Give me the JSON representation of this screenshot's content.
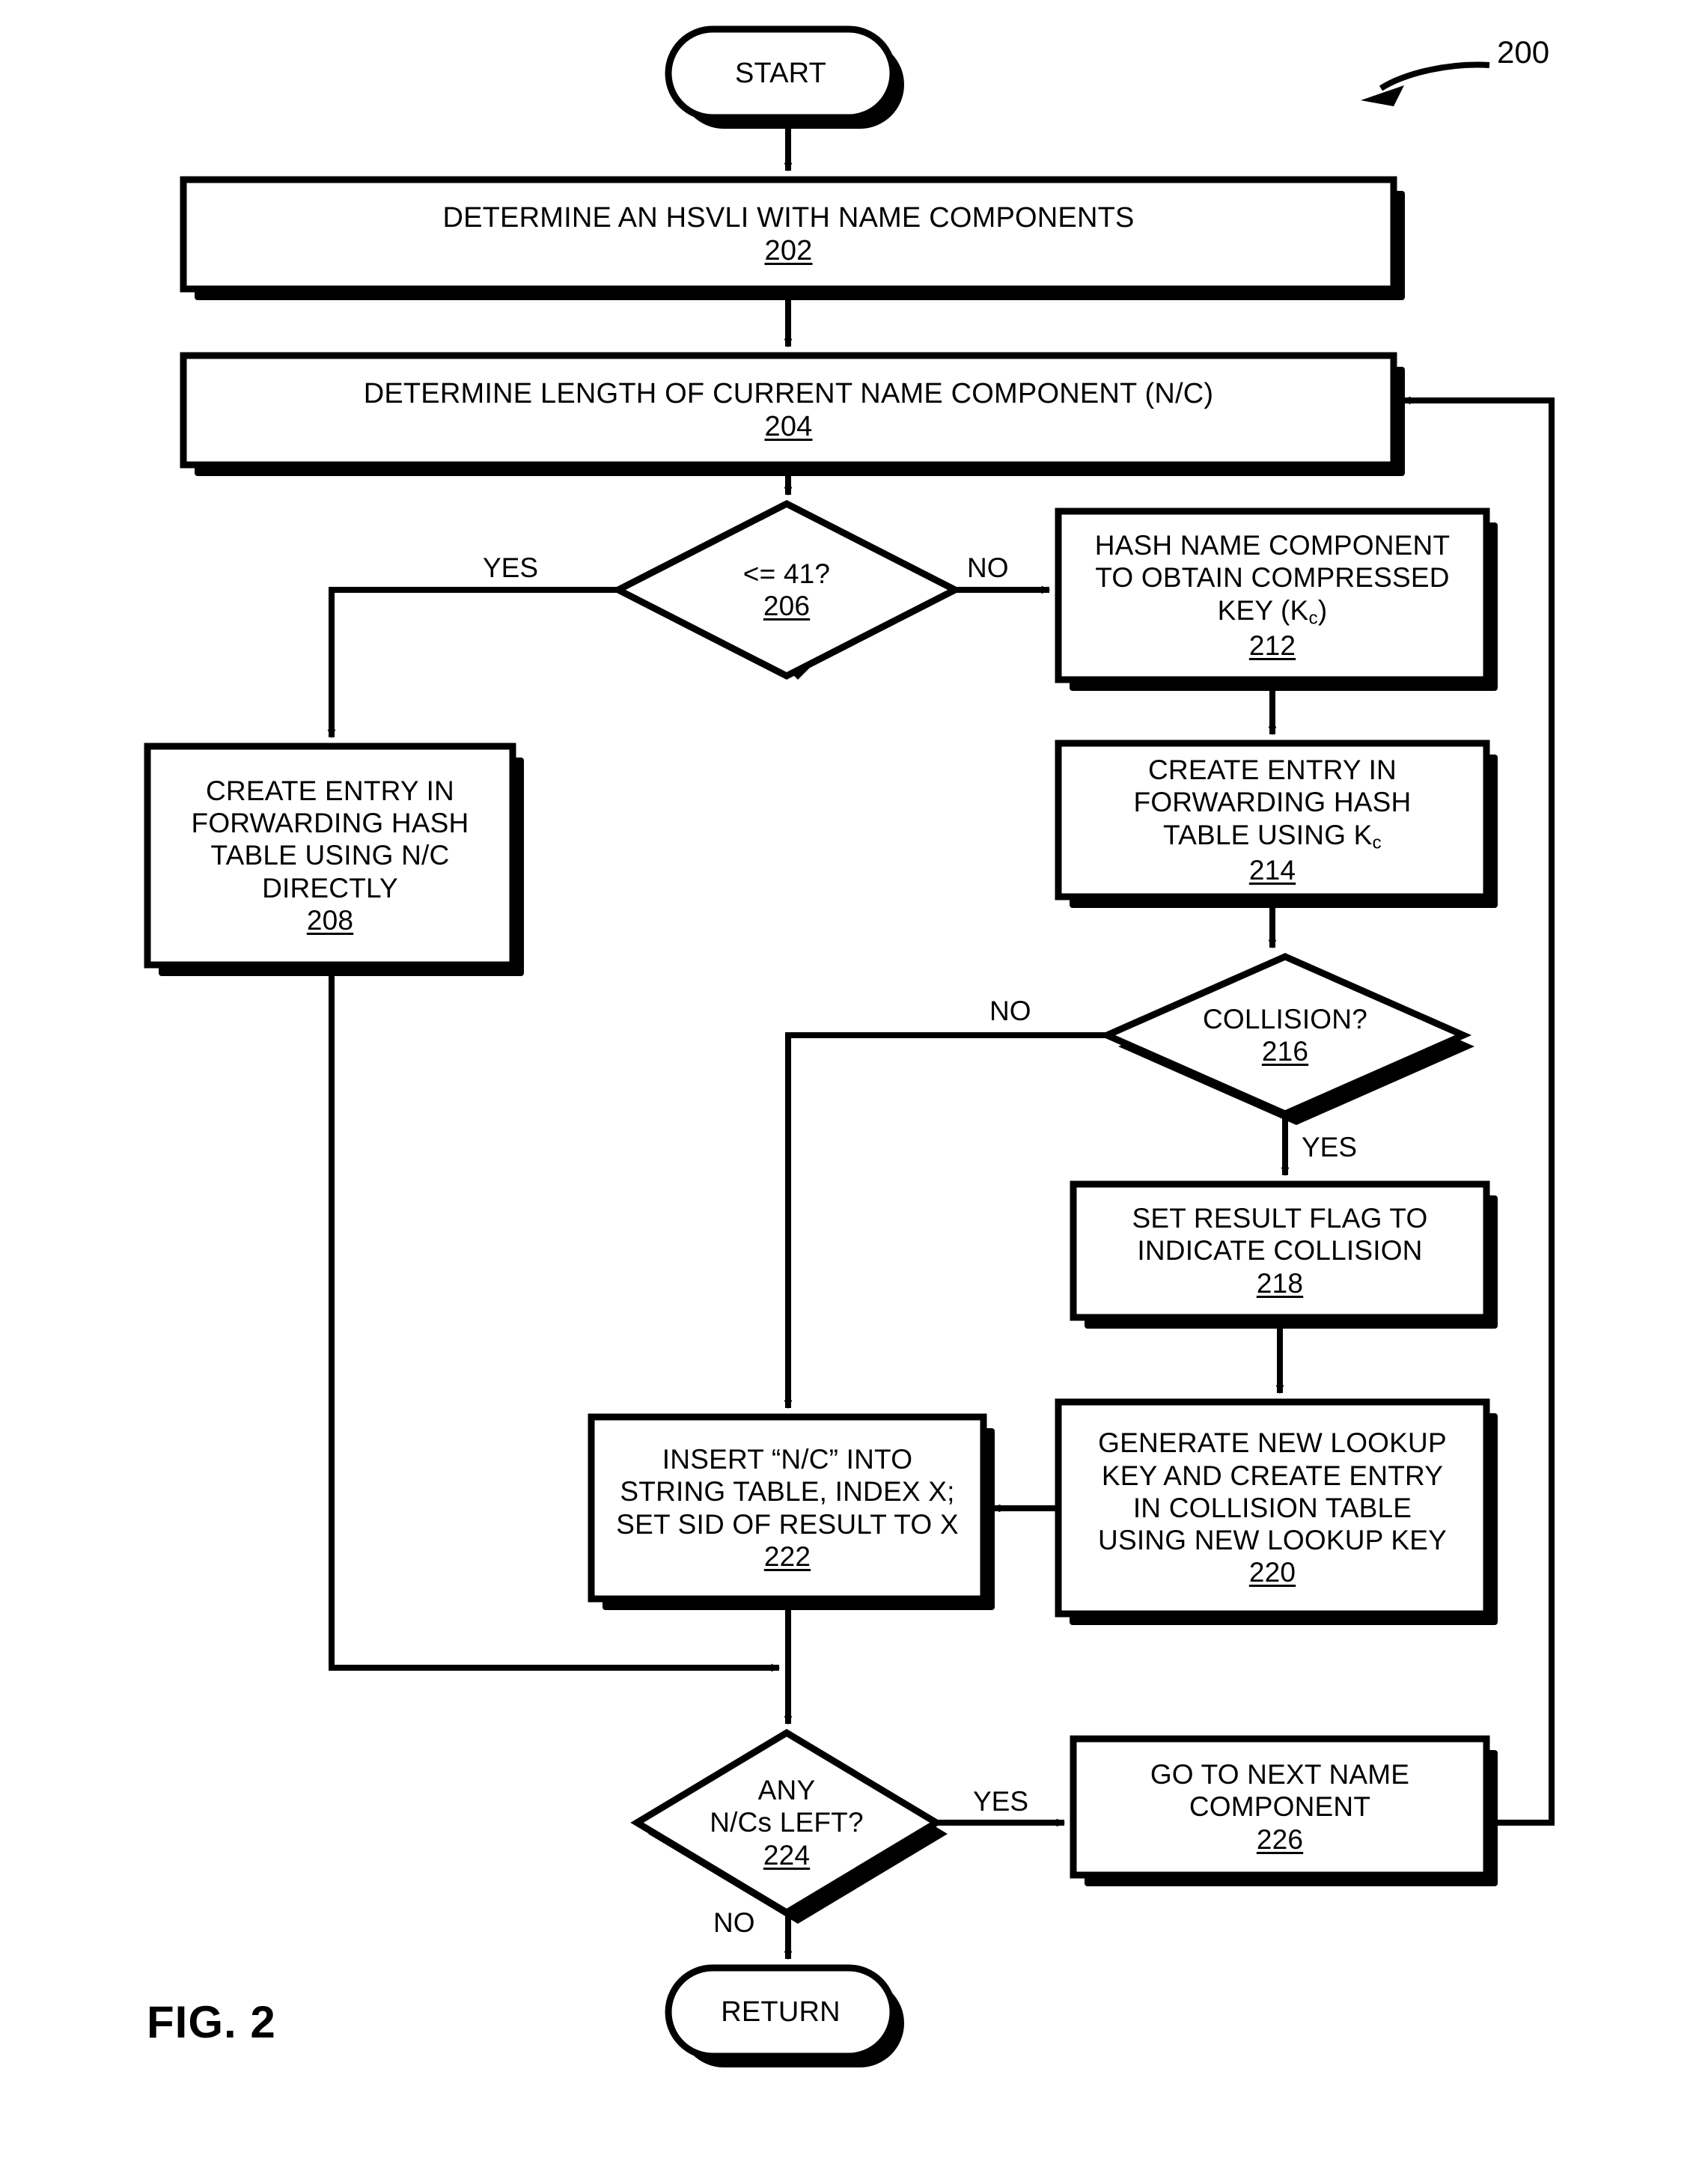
{
  "figure": {
    "label": "FIG. 2",
    "reference_numeral": "200"
  },
  "nodes": {
    "start": {
      "id": "start",
      "shape": "terminal",
      "label": "START"
    },
    "n202": {
      "id": "202",
      "shape": "process",
      "lines": [
        "DETERMINE AN HSVLI WITH NAME COMPONENTS"
      ],
      "ref": "202"
    },
    "n204": {
      "id": "204",
      "shape": "process",
      "lines": [
        "DETERMINE LENGTH OF CURRENT NAME COMPONENT (N/C)"
      ],
      "ref": "204"
    },
    "n206": {
      "id": "206",
      "shape": "decision",
      "lines": [
        "<= 41?"
      ],
      "ref": "206"
    },
    "n208": {
      "id": "208",
      "shape": "process",
      "lines": [
        "CREATE ENTRY IN",
        "FORWARDING HASH",
        "TABLE USING N/C",
        "DIRECTLY"
      ],
      "ref": "208"
    },
    "n212": {
      "id": "212",
      "shape": "process",
      "lines": [
        "HASH NAME COMPONENT",
        "TO OBTAIN COMPRESSED",
        "KEY (K<sub>c</sub>)"
      ],
      "ref": "212"
    },
    "n214": {
      "id": "214",
      "shape": "process",
      "lines": [
        "CREATE ENTRY IN",
        "FORWARDING HASH",
        "TABLE USING K<sub>c</sub>"
      ],
      "ref": "214"
    },
    "n216": {
      "id": "216",
      "shape": "decision",
      "lines": [
        "COLLISION?"
      ],
      "ref": "216"
    },
    "n218": {
      "id": "218",
      "shape": "process",
      "lines": [
        "SET RESULT FLAG TO",
        "INDICATE COLLISION"
      ],
      "ref": "218"
    },
    "n220": {
      "id": "220",
      "shape": "process",
      "lines": [
        "GENERATE NEW LOOKUP",
        "KEY AND CREATE ENTRY",
        "IN COLLISION TABLE",
        "USING NEW LOOKUP KEY"
      ],
      "ref": "220"
    },
    "n222": {
      "id": "222",
      "shape": "process",
      "lines": [
        "INSERT “N/C” INTO",
        "STRING TABLE, INDEX X;",
        "SET SID OF RESULT TO X"
      ],
      "ref": "222"
    },
    "n224": {
      "id": "224",
      "shape": "decision",
      "lines": [
        "ANY",
        "N/Cs LEFT?"
      ],
      "ref": "224"
    },
    "n226": {
      "id": "226",
      "shape": "process",
      "lines": [
        "GO TO NEXT NAME",
        "COMPONENT"
      ],
      "ref": "226"
    },
    "return": {
      "id": "return",
      "shape": "terminal",
      "label": "RETURN"
    }
  },
  "edge_labels": {
    "yes_206": "YES",
    "no_206": "NO",
    "no_216": "NO",
    "yes_216": "YES",
    "yes_224": "YES",
    "no_224": "NO"
  },
  "colors": {
    "stroke": "#000000",
    "fill": "#ffffff",
    "shadow": "#000000"
  }
}
